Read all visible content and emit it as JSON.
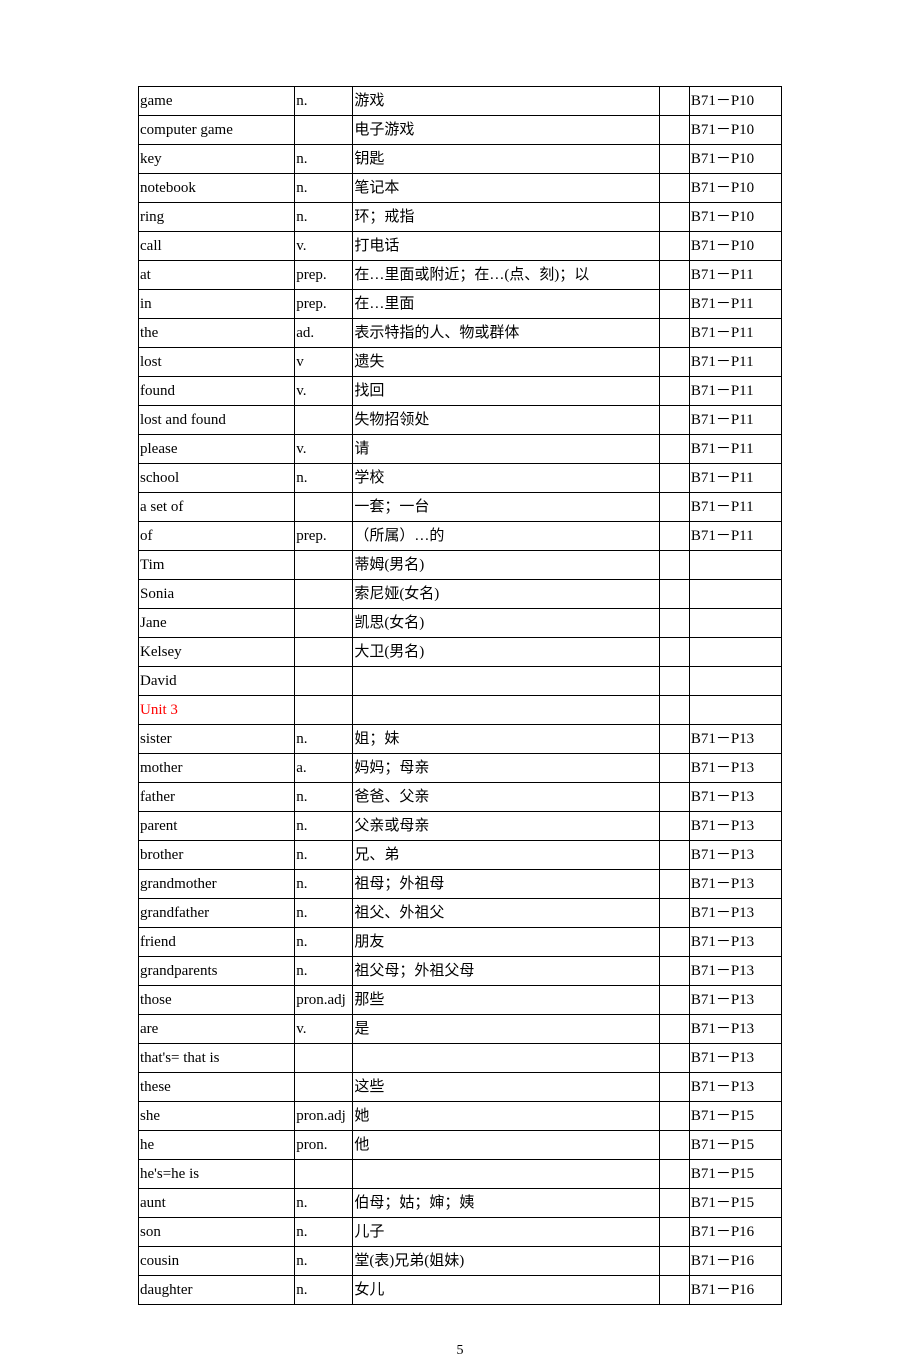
{
  "page_number": "5",
  "rows": [
    {
      "word": "game",
      "pos": "n.",
      "def": "游戏",
      "c4": "",
      "ref": "B71－P10"
    },
    {
      "word": "computer game",
      "pos": "",
      "def": "电子游戏",
      "c4": "",
      "ref": "B71－P10"
    },
    {
      "word": "key",
      "pos": "n.",
      "def": "钥匙",
      "c4": "",
      "ref": "B71－P10"
    },
    {
      "word": "notebook",
      "pos": "n.",
      "def": "笔记本",
      "c4": "",
      "ref": "B71－P10"
    },
    {
      "word": "ring",
      "pos": "n.",
      "def": "环；戒指",
      "c4": "",
      "ref": "B71－P10"
    },
    {
      "word": "call",
      "pos": "v.",
      "def": "打电话",
      "c4": "",
      "ref": "B71－P10"
    },
    {
      "word": "at",
      "pos": "prep.",
      "def": "在…里面或附近；在…(点、刻)；以",
      "c4": "",
      "ref": "B71－P11"
    },
    {
      "word": "in",
      "pos": "prep.",
      "def": "在…里面",
      "c4": "",
      "ref": "B71－P11"
    },
    {
      "word": "the",
      "pos": "ad.",
      "def": "表示特指的人、物或群体",
      "c4": "",
      "ref": "B71－P11"
    },
    {
      "word": "lost",
      "pos": "v",
      "def": "遗失",
      "c4": "",
      "ref": "B71－P11"
    },
    {
      "word": "found",
      "pos": "v.",
      "def": "找回",
      "c4": "",
      "ref": "B71－P11"
    },
    {
      "word": "lost and found",
      "pos": "",
      "def": "失物招领处",
      "c4": "",
      "ref": "B71－P11"
    },
    {
      "word": "please",
      "pos": "v.",
      "def": "请",
      "c4": "",
      "ref": "B71－P11"
    },
    {
      "word": "school",
      "pos": "n.",
      "def": "学校",
      "c4": "",
      "ref": "B71－P11"
    },
    {
      "word": "a set of",
      "pos": "",
      "def": "一套；一台",
      "c4": "",
      "ref": "B71－P11"
    },
    {
      "word": "of",
      "pos": "prep.",
      "def": "（所属）…的",
      "c4": "",
      "ref": "B71－P11"
    },
    {
      "word": "Tim",
      "pos": "",
      "def": "蒂姆(男名)",
      "c4": "",
      "ref": ""
    },
    {
      "word": "Sonia",
      "pos": "",
      "def": "索尼娅(女名)",
      "c4": "",
      "ref": ""
    },
    {
      "word": "Jane",
      "pos": "",
      "def": "凯思(女名)",
      "c4": "",
      "ref": ""
    },
    {
      "word": "Kelsey",
      "pos": "",
      "def": "大卫(男名)",
      "c4": "",
      "ref": ""
    },
    {
      "word": "David",
      "pos": "",
      "def": "",
      "c4": "",
      "ref": ""
    },
    {
      "word": "Unit 3",
      "pos": "",
      "def": "",
      "c4": "",
      "ref": "",
      "unit": true
    },
    {
      "word": "sister",
      "pos": "n.",
      "def": "姐；妹",
      "c4": "",
      "ref": "B71－P13"
    },
    {
      "word": "mother",
      "pos": "a.",
      "def": "妈妈；母亲",
      "c4": "",
      "ref": "B71－P13"
    },
    {
      "word": "father",
      "pos": "n.",
      "def": "爸爸、父亲",
      "c4": "",
      "ref": "B71－P13"
    },
    {
      "word": "parent",
      "pos": "n.",
      "def": "父亲或母亲",
      "c4": "",
      "ref": "B71－P13"
    },
    {
      "word": "brother",
      "pos": "n.",
      "def": "兄、弟",
      "c4": "",
      "ref": "B71－P13"
    },
    {
      "word": "grandmother",
      "pos": "n.",
      "def": "祖母；外祖母",
      "c4": "",
      "ref": "B71－P13"
    },
    {
      "word": "grandfather",
      "pos": "n.",
      "def": "祖父、外祖父",
      "c4": "",
      "ref": "B71－P13"
    },
    {
      "word": "friend",
      "pos": "n.",
      "def": "朋友",
      "c4": "",
      "ref": "B71－P13"
    },
    {
      "word": "grandparents",
      "pos": "n.",
      "def": "祖父母；外祖父母",
      "c4": "",
      "ref": "B71－P13"
    },
    {
      "word": "those",
      "pos": "pron.adj",
      "def": "那些",
      "c4": "",
      "ref": "B71－P13"
    },
    {
      "word": "are",
      "pos": "v.",
      "def": "是",
      "c4": "",
      "ref": "B71－P13"
    },
    {
      "word": "that's= that is",
      "pos": "",
      "def": "",
      "c4": "",
      "ref": "B71－P13"
    },
    {
      "word": "these",
      "pos": "",
      "def": "这些",
      "c4": "",
      "ref": "B71－P13"
    },
    {
      "word": "she",
      "pos": "pron.adj",
      "def": "她",
      "c4": "",
      "ref": "B71－P15"
    },
    {
      "word": "he",
      "pos": "pron.",
      "def": "他",
      "c4": "",
      "ref": "B71－P15"
    },
    {
      "word": "he's=he is",
      "pos": "",
      "def": "",
      "c4": "",
      "ref": "B71－P15"
    },
    {
      "word": "aunt",
      "pos": "n.",
      "def": "伯母；姑；婶；姨",
      "c4": "",
      "ref": "B71－P15"
    },
    {
      "word": "son",
      "pos": "n.",
      "def": "儿子",
      "c4": "",
      "ref": "B71－P16"
    },
    {
      "word": "cousin",
      "pos": "n.",
      "def": "堂(表)兄弟(姐妹)",
      "c4": "",
      "ref": "B71－P16"
    },
    {
      "word": "daughter",
      "pos": "n.",
      "def": "女儿",
      "c4": "",
      "ref": "B71－P16"
    }
  ]
}
